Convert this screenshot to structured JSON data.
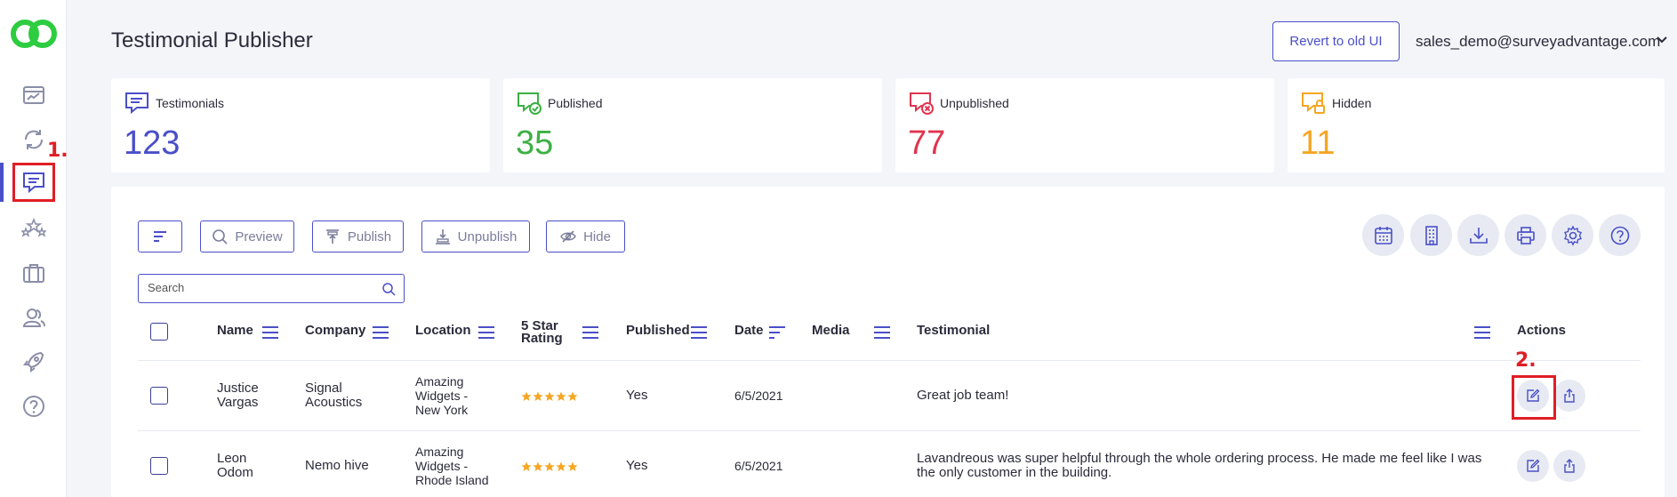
{
  "header": {
    "title": "Testimonial Publisher",
    "revert_label": "Revert to old UI",
    "user_email": "sales_demo@surveyadvantage.com"
  },
  "annotations": {
    "step1": "1.",
    "step2": "2."
  },
  "stats": [
    {
      "label": "Testimonials",
      "value": "123",
      "color": "#4a4fc8",
      "icon": "testimonials-icon"
    },
    {
      "label": "Published",
      "value": "35",
      "color": "#3cb043",
      "icon": "published-icon"
    },
    {
      "label": "Unpublished",
      "value": "77",
      "color": "#e0344f",
      "icon": "unpublished-icon"
    },
    {
      "label": "Hidden",
      "value": "11",
      "color": "#f5a623",
      "icon": "hidden-icon"
    }
  ],
  "toolbar": {
    "preview": "Preview",
    "publish": "Publish",
    "unpublish": "Unpublish",
    "hide": "Hide"
  },
  "search": {
    "placeholder": "Search"
  },
  "table": {
    "columns": {
      "name": "Name",
      "company": "Company",
      "location": "Location",
      "rating_line1": "5 Star",
      "rating_line2": "Rating",
      "published": "Published",
      "date": "Date",
      "media": "Media",
      "testimonial": "Testimonial",
      "actions": "Actions"
    },
    "rows": [
      {
        "name_line1": "Justice",
        "name_line2": "Vargas",
        "company_line1": "Signal",
        "company_line2": "Acoustics",
        "location_line1": "Amazing",
        "location_line2": "Widgets -",
        "location_line3": "New York",
        "rating": 5,
        "published": "Yes",
        "date": "6/5/2021",
        "testimonial_line1": "Great job team!",
        "testimonial_line2": ""
      },
      {
        "name_line1": "Leon",
        "name_line2": "Odom",
        "company_line1": "Nemo hive",
        "company_line2": "",
        "location_line1": "Amazing",
        "location_line2": "Widgets -",
        "location_line3": "Rhode Island",
        "rating": 5,
        "published": "Yes",
        "date": "6/5/2021",
        "testimonial_line1": "Lavandreous was super helpful through the whole ordering process. He made me feel like I was",
        "testimonial_line2": "the only customer in the building."
      }
    ]
  },
  "colors": {
    "accent": "#4a4fc8",
    "annotation_red": "#e01e25",
    "star": "#f5a623",
    "logo_green": "#2ecc40"
  }
}
